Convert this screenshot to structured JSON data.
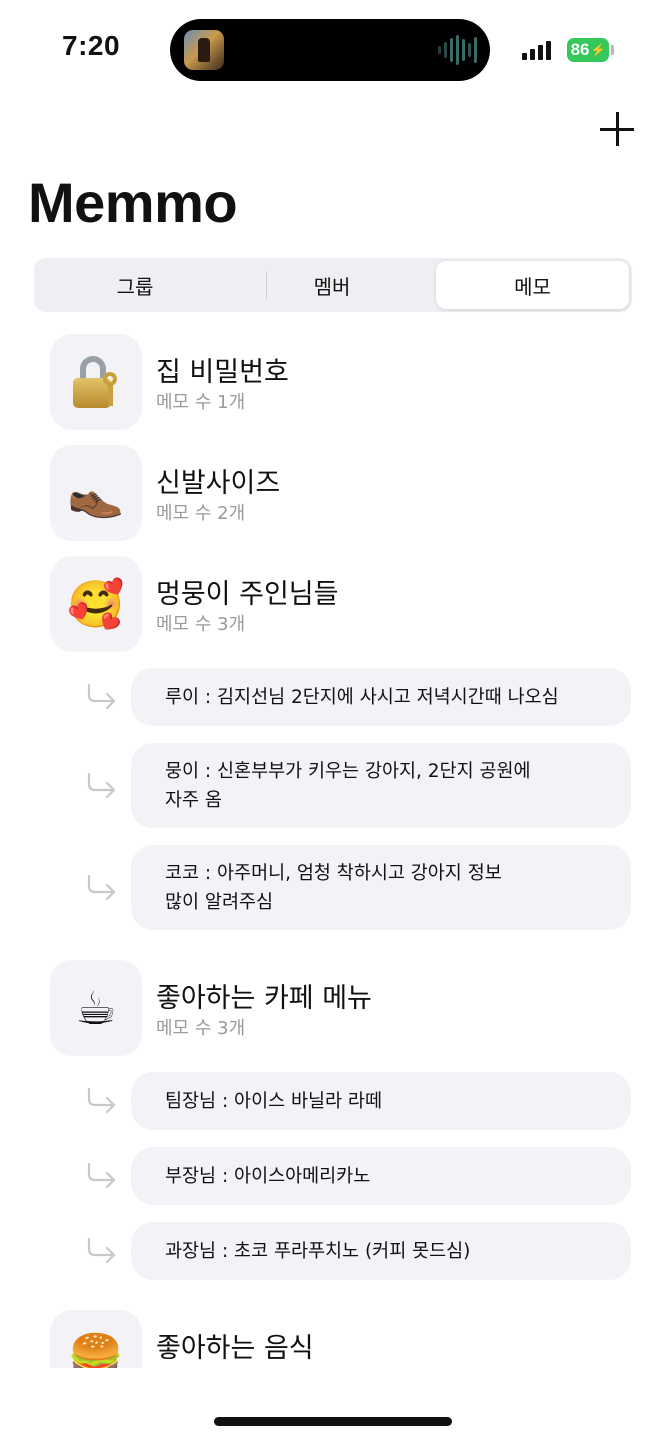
{
  "status_bar": {
    "time": "7:20",
    "battery": "86"
  },
  "header": {
    "title": "Memmo"
  },
  "tabs": [
    {
      "label": "그룹",
      "active": false
    },
    {
      "label": "멤버",
      "active": false
    },
    {
      "label": "메모",
      "active": true
    }
  ],
  "groups": [
    {
      "icon": "lock-with-key-icon",
      "emoji": "🔐",
      "name": "집 비밀번호",
      "count": "메모 수 1개",
      "memos": []
    },
    {
      "icon": "shoe-icon",
      "emoji": "👞",
      "name": "신발사이즈",
      "count": "메모 수 2개",
      "memos": []
    },
    {
      "icon": "smiling-face-hearts-icon",
      "emoji": "🥰",
      "name": "멍뭉이 주인님들",
      "count": "메모 수 3개",
      "memos": [
        {
          "lines": [
            "루이 : 김지선님 2단지에 사시고 저녁시간때 나오심"
          ]
        },
        {
          "lines": [
            "뭉이 : 신혼부부가 키우는 강아지, 2단지 공원에",
            "자주 옴"
          ]
        },
        {
          "lines": [
            "코코 : 아주머니, 엄청 착하시고 강아지 정보",
            "많이 알려주심"
          ]
        }
      ]
    },
    {
      "icon": "hot-beverage-icon",
      "emoji": "☕",
      "name": "좋아하는 카페 메뉴",
      "count": "메모 수 3개",
      "memos": [
        {
          "lines": [
            "팀장님 : 아이스 바닐라 라떼"
          ]
        },
        {
          "lines": [
            "부장님 : 아이스아메리카노"
          ]
        },
        {
          "lines": [
            "과장님 : 초코 푸라푸치노 (커피 못드심)"
          ]
        }
      ]
    },
    {
      "icon": "hamburger-icon",
      "emoji": "🍔",
      "name": "좋아하는 음식",
      "count": "",
      "memos": []
    }
  ],
  "colors": {
    "accent": "#111111",
    "card": "#f2f2f7",
    "subtext": "#9a9aa0",
    "battery": "#34c759"
  }
}
